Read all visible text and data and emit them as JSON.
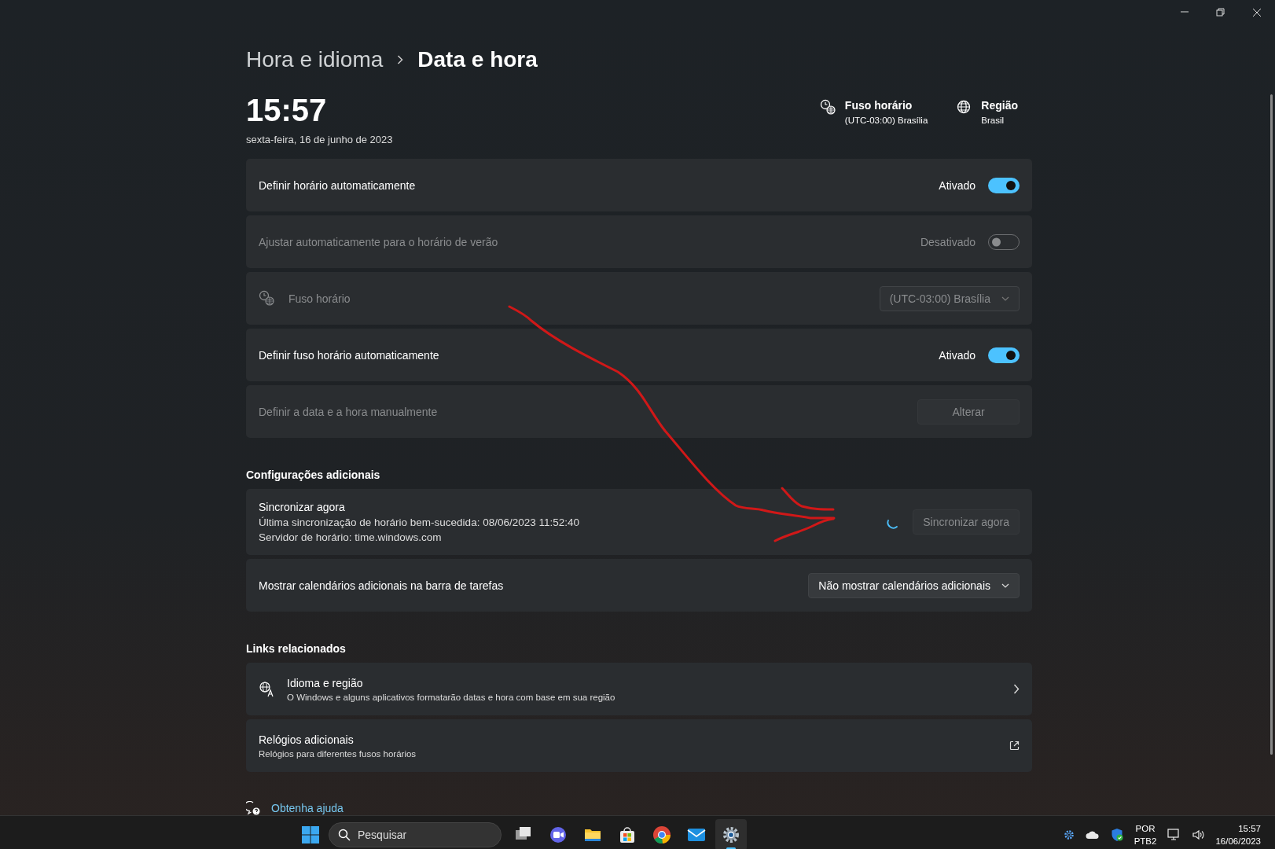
{
  "breadcrumb": [
    {
      "label": "Hora e idioma",
      "current": false
    },
    {
      "label": "Data e hora",
      "current": true
    }
  ],
  "clock": {
    "time": "15:57",
    "date": "sexta-feira, 16 de junho de 2023"
  },
  "header_info": [
    {
      "kind": "timezone",
      "title": "Fuso horário",
      "value": "(UTC-03:00) Brasília"
    },
    {
      "kind": "region",
      "title": "Região",
      "value": "Brasil"
    }
  ],
  "settings": [
    {
      "kind": "toggle",
      "label": "Definir horário automaticamente",
      "disabled": false,
      "on": true,
      "state_text": "Ativado"
    },
    {
      "kind": "toggle",
      "label": "Ajustar automaticamente para o horário de verão",
      "disabled": true,
      "on": false,
      "state_text": "Desativado"
    },
    {
      "kind": "dropdown",
      "label": "Fuso horário",
      "disabled": true,
      "has_icon": true,
      "value": "(UTC-03:00) Brasília"
    },
    {
      "kind": "toggle",
      "label": "Definir fuso horário automaticamente",
      "disabled": false,
      "on": true,
      "state_text": "Ativado"
    },
    {
      "kind": "button",
      "label": "Definir a data e a hora manualmente",
      "disabled": true,
      "button": "Alterar"
    }
  ],
  "additional": {
    "heading": "Configurações adicionais",
    "items": [
      {
        "kind": "sync",
        "label": "Sincronizar agora",
        "lines": [
          "Última sincronização de horário bem-sucedida: 08/06/2023 11:52:40",
          "Servidor de horário: time.windows.com"
        ],
        "busy": true,
        "disabled": true,
        "button": "Sincronizar agora"
      },
      {
        "kind": "dropdown",
        "label": "Mostrar calendários adicionais na barra de tarefas",
        "disabled": false,
        "has_icon": false,
        "value": "Não mostrar calendários adicionais"
      }
    ]
  },
  "related": {
    "heading": "Links relacionados",
    "items": [
      {
        "kind": "internal",
        "title": "Idioma e região",
        "subtitle": "O Windows e alguns aplicativos formatarão datas e hora com base em sua região",
        "has_icon": true
      },
      {
        "kind": "external",
        "title": "Relógios adicionais",
        "subtitle": "Relógios para diferentes fusos horários",
        "has_icon": false
      }
    ]
  },
  "help": {
    "label": "Obtenha ajuda"
  },
  "taskbar": {
    "search_placeholder": "Pesquisar",
    "apps": [
      {
        "kind": "taskview",
        "selected": false
      },
      {
        "kind": "chat",
        "selected": false
      },
      {
        "kind": "folder",
        "selected": false
      },
      {
        "kind": "store",
        "selected": false
      },
      {
        "kind": "browser",
        "selected": false
      },
      {
        "kind": "mail",
        "selected": false
      },
      {
        "kind": "settings",
        "selected": true
      }
    ],
    "tray": {
      "language": "POR",
      "layout": "PTB2",
      "time": "15:57",
      "date": "16/06/2023"
    }
  }
}
